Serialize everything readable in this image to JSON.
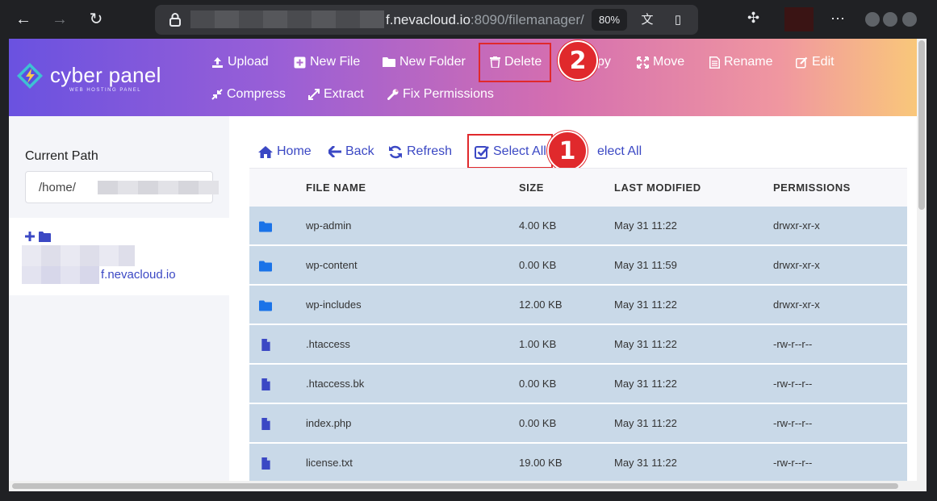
{
  "browser": {
    "url_host": "f.nevacloud.io",
    "url_path": ":8090/filemanager/",
    "zoom": "80%"
  },
  "header": {
    "logo_text": "cyber panel",
    "logo_sub": "WEB HOSTING PANEL",
    "toolbar": {
      "upload": "Upload",
      "new_file": "New File",
      "new_folder": "New Folder",
      "delete": "Delete",
      "copy": "py",
      "move": "Move",
      "rename": "Rename",
      "edit": "Edit",
      "compress": "Compress",
      "extract": "Extract",
      "fix_permissions": "Fix Permissions"
    }
  },
  "annotations": {
    "step1": "1",
    "step2": "2"
  },
  "sidebar": {
    "current_path_label": "Current Path",
    "current_path_value": "/home/",
    "tree_domain": "f.nevacloud.io"
  },
  "nav": {
    "home": "Home",
    "back": "Back",
    "refresh": "Refresh",
    "select_all": "Select All",
    "unselect_all": "elect All"
  },
  "table": {
    "headers": {
      "name": "FILE NAME",
      "size": "SIZE",
      "modified": "LAST MODIFIED",
      "permissions": "PERMISSIONS"
    },
    "rows": [
      {
        "type": "folder",
        "name": "wp-admin",
        "size": "4.00 KB",
        "modified": "May 31 11:22",
        "permissions": "drwxr-xr-x"
      },
      {
        "type": "folder",
        "name": "wp-content",
        "size": "0.00 KB",
        "modified": "May 31 11:59",
        "permissions": "drwxr-xr-x"
      },
      {
        "type": "folder",
        "name": "wp-includes",
        "size": "12.00 KB",
        "modified": "May 31 11:22",
        "permissions": "drwxr-xr-x"
      },
      {
        "type": "file",
        "name": ".htaccess",
        "size": "1.00 KB",
        "modified": "May 31 11:22",
        "permissions": "-rw-r--r--"
      },
      {
        "type": "file",
        "name": ".htaccess.bk",
        "size": "0.00 KB",
        "modified": "May 31 11:22",
        "permissions": "-rw-r--r--"
      },
      {
        "type": "file",
        "name": "index.php",
        "size": "0.00 KB",
        "modified": "May 31 11:22",
        "permissions": "-rw-r--r--"
      },
      {
        "type": "file",
        "name": "license.txt",
        "size": "19.00 KB",
        "modified": "May 31 11:22",
        "permissions": "-rw-r--r--"
      }
    ]
  },
  "colors": {
    "accent": "#3b48c4",
    "folder_icon": "#1a73e8",
    "file_icon": "#3b48c4",
    "row_selected": "#c9d9e8",
    "annotation": "#e0292c"
  }
}
